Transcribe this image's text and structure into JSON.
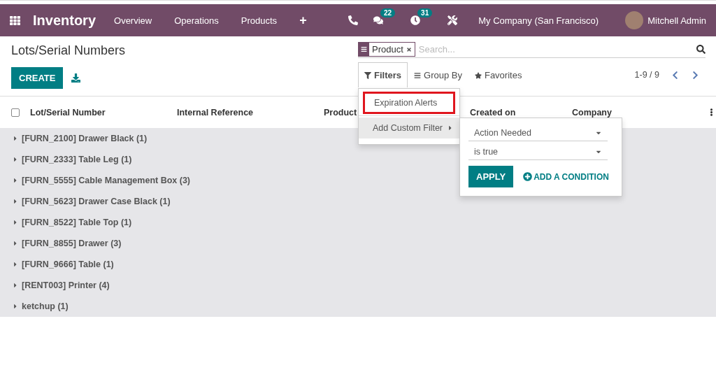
{
  "navbar": {
    "app_title": "Inventory",
    "menu": [
      "Overview",
      "Operations",
      "Products"
    ],
    "add_label": "+",
    "systray": [
      {
        "kind": "phone"
      },
      {
        "kind": "chat",
        "badge": "22"
      },
      {
        "kind": "activity",
        "badge": "31"
      },
      {
        "kind": "tools"
      }
    ],
    "company": "My Company (San Francisco)",
    "user": "Mitchell Admin"
  },
  "breadcrumb": "Lots/Serial Numbers",
  "create_button": "CREATE",
  "search": {
    "facet": "Product",
    "placeholder": "Search..."
  },
  "search_tabs": [
    {
      "kind": "filter",
      "label": "Filters",
      "selected": true
    },
    {
      "kind": "group",
      "label": "Group By",
      "selected": false
    },
    {
      "kind": "star",
      "label": "Favorites",
      "selected": false
    }
  ],
  "pager": "1-9 / 9",
  "filters_menu": {
    "items": [
      {
        "label": "Expiration Alerts",
        "highlighted": true
      }
    ],
    "custom_filter": {
      "label": "Add Custom Filter",
      "expanded": true
    },
    "condition": {
      "field": "Action Needed",
      "operator": "is true",
      "apply": "APPLY",
      "add": "ADD A CONDITION"
    }
  },
  "table": {
    "select_all_checked": false,
    "columns": [
      "Lot/Serial Number",
      "Internal Reference",
      "Product",
      "Created on",
      "Company"
    ],
    "groups": [
      {
        "label": "[FURN_2100] Drawer Black (1)",
        "expanded": false
      },
      {
        "label": "[FURN_2333] Table Leg (1)",
        "expanded": false
      },
      {
        "label": "[FURN_5555] Cable Management Box (3)",
        "expanded": false
      },
      {
        "label": "[FURN_5623] Drawer Case Black (1)",
        "expanded": false
      },
      {
        "label": "[FURN_8522] Table Top (1)",
        "expanded": false
      },
      {
        "label": "[FURN_8855] Drawer (3)",
        "expanded": false
      },
      {
        "label": "[FURN_9666] Table (1)",
        "expanded": false
      },
      {
        "label": "[RENT003] Printer (4)",
        "expanded": false
      },
      {
        "label": "ketchup (1)",
        "expanded": false
      }
    ]
  }
}
